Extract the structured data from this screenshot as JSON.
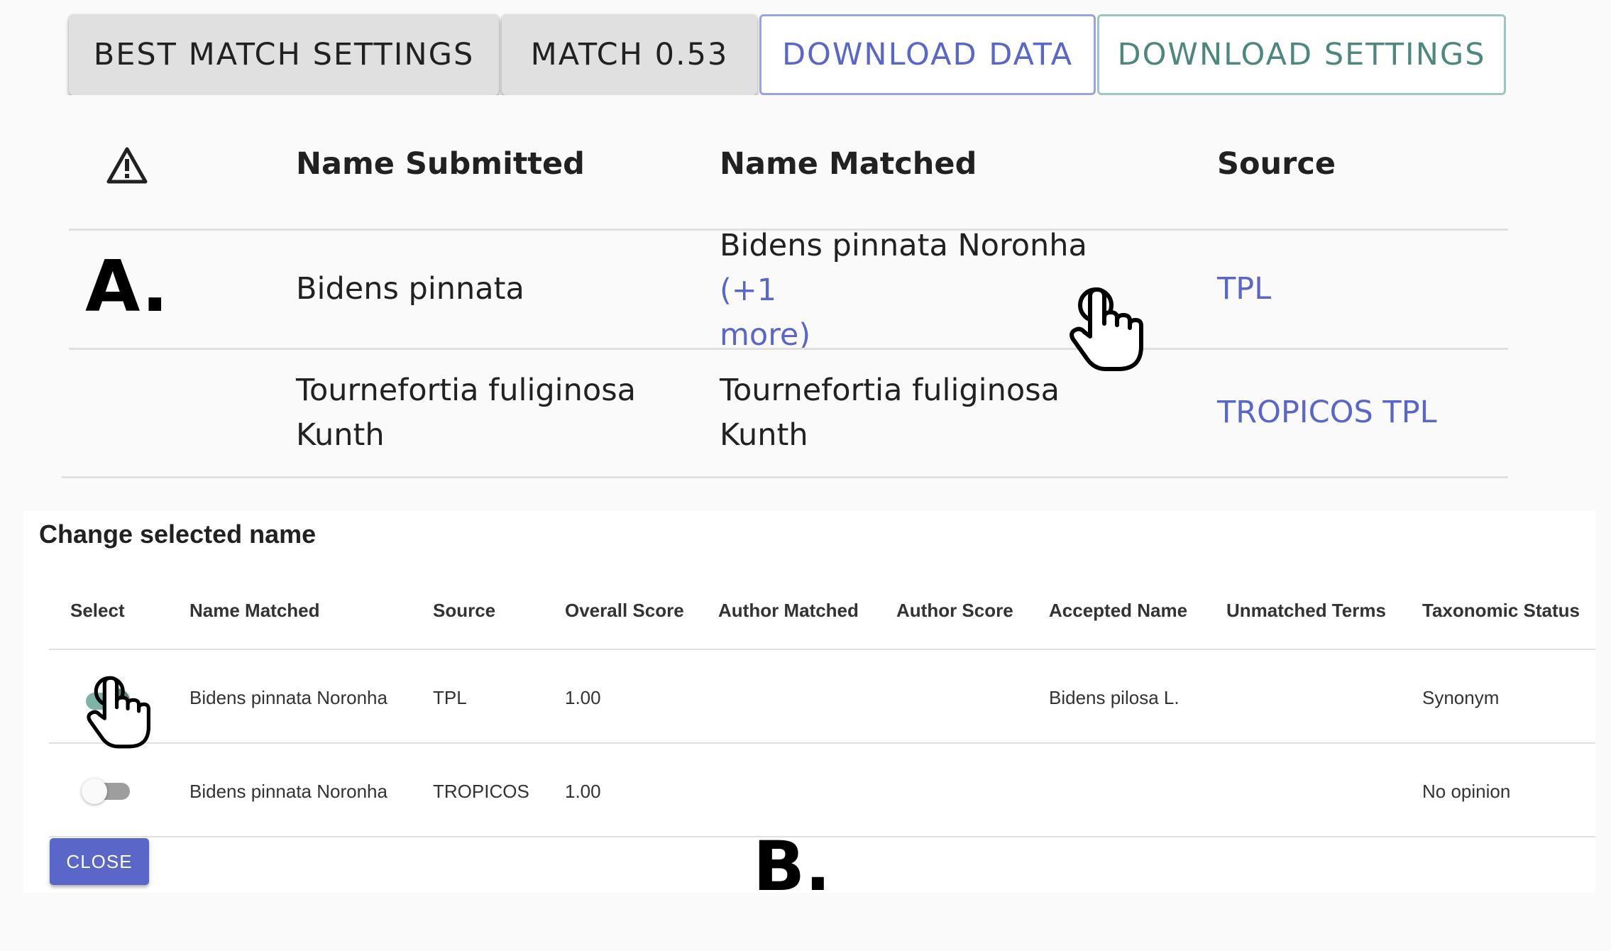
{
  "toolbar": {
    "best_match_settings": "BEST MATCH SETTINGS",
    "match_label": "MATCH 0.53",
    "download_data": "DOWNLOAD DATA",
    "download_settings": "DOWNLOAD SETTINGS"
  },
  "results_table": {
    "headers": {
      "warning_icon": "warning-icon",
      "name_submitted": "Name Submitted",
      "name_matched": "Name Matched",
      "source": "Source"
    },
    "rows": [
      {
        "name_submitted": "Bidens pinnata",
        "name_matched": "Bidens pinnata Noronha",
        "more_link_line1": "(+1",
        "more_link_line2": "more)",
        "source": "TPL"
      },
      {
        "name_submitted_line1": "Tournefortia fuliginosa",
        "name_submitted_line2": "Kunth",
        "name_matched_line1": "Tournefortia fuliginosa",
        "name_matched_line2": "Kunth",
        "source": "TROPICOS TPL"
      }
    ]
  },
  "panel_labels": {
    "a": "A.",
    "b": "B."
  },
  "dialog": {
    "title": "Change selected name",
    "headers": [
      "Select",
      "Name Matched",
      "Source",
      "Overall Score",
      "Author Matched",
      "Author Score",
      "Accepted Name",
      "Unmatched Terms",
      "Taxonomic Status"
    ],
    "rows": [
      {
        "selected": true,
        "name_matched": "Bidens pinnata Noronha",
        "source": "TPL",
        "overall_score": "1.00",
        "author_matched": "",
        "author_score": "",
        "accepted_name": "Bidens pilosa L.",
        "unmatched_terms": "",
        "taxonomic_status": "Synonym"
      },
      {
        "selected": false,
        "name_matched": "Bidens pinnata Noronha",
        "source": "TROPICOS",
        "overall_score": "1.00",
        "author_matched": "",
        "author_score": "",
        "accepted_name": "",
        "unmatched_terms": "",
        "taxonomic_status": "No opinion"
      }
    ],
    "close_label": "CLOSE"
  },
  "colors": {
    "primary": "#5a67c9",
    "teal": "#4e877e",
    "switch_on": "#7fb3a8",
    "switch_off": "#9e9e9e"
  },
  "icons": {
    "pointer_hand": "hand-pointer-icon",
    "warning": "warning-icon"
  }
}
